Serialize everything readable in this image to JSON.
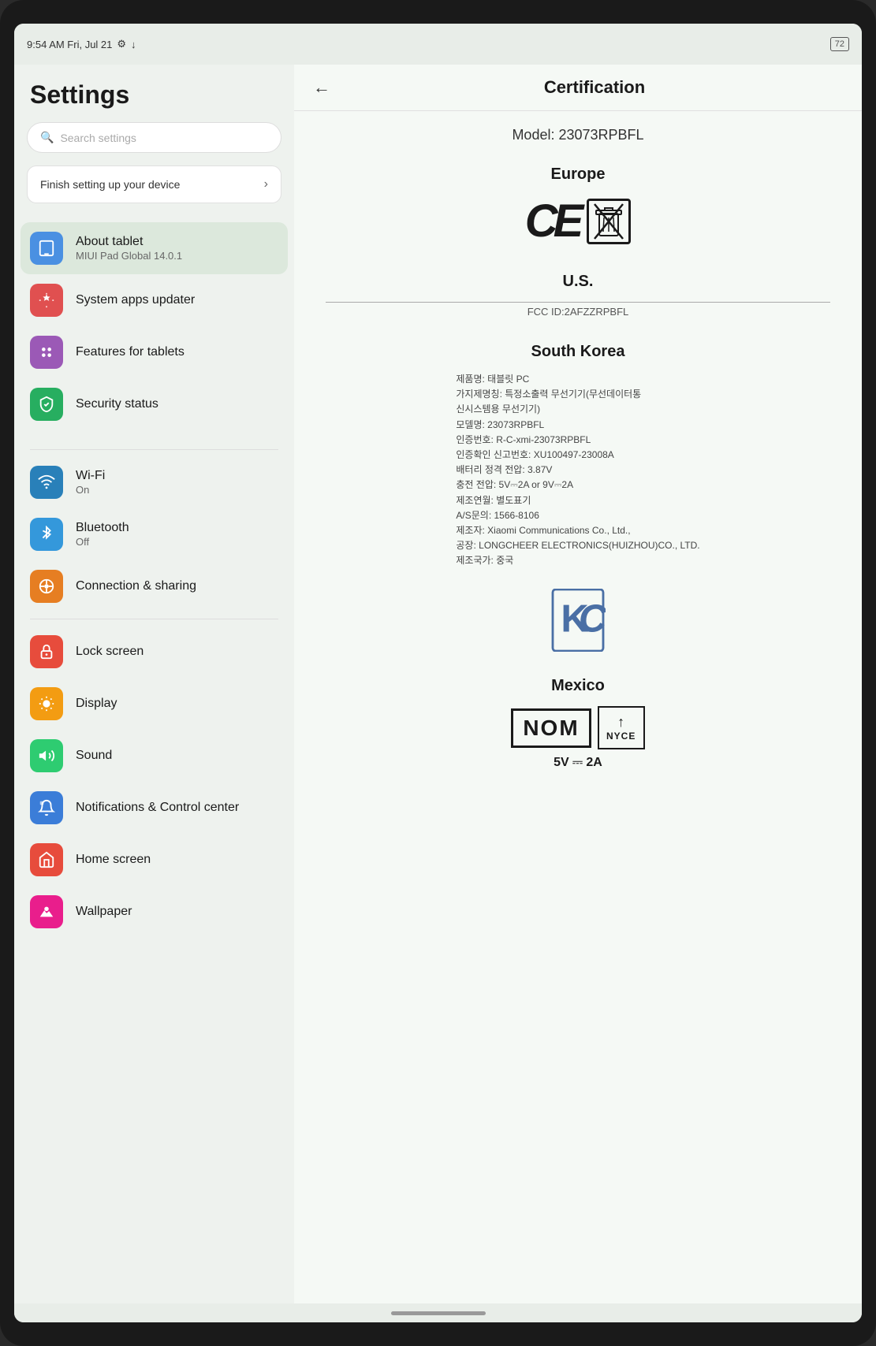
{
  "statusBar": {
    "time": "9:54 AM Fri, Jul 21",
    "battery": "72"
  },
  "sidebar": {
    "title": "Settings",
    "search": {
      "placeholder": "Search settings"
    },
    "setup": {
      "label": "Finish setting up your device"
    },
    "items": [
      {
        "id": "about-tablet",
        "label": "About tablet",
        "sublabel": "MIUI Pad Global 14.0.1",
        "icon": "tablet-icon",
        "iconClass": "icon-blue",
        "iconSymbol": "⊡",
        "active": false
      },
      {
        "id": "system-apps",
        "label": "System apps updater",
        "sublabel": "",
        "icon": "update-icon",
        "iconClass": "icon-red",
        "iconSymbol": "↑",
        "active": false
      },
      {
        "id": "features-tablets",
        "label": "Features for tablets",
        "sublabel": "",
        "icon": "features-icon",
        "iconClass": "icon-purple",
        "iconSymbol": "⋮⋮",
        "active": false
      },
      {
        "id": "security-status",
        "label": "Security status",
        "sublabel": "",
        "icon": "security-icon",
        "iconClass": "icon-green-dark",
        "iconSymbol": "✓",
        "active": false
      },
      {
        "id": "wifi",
        "label": "Wi-Fi",
        "sublabel": "On",
        "icon": "wifi-icon",
        "iconClass": "icon-blue2",
        "iconSymbol": "📶",
        "active": false
      },
      {
        "id": "bluetooth",
        "label": "Bluetooth",
        "sublabel": "Off",
        "icon": "bluetooth-icon",
        "iconClass": "icon-blue3",
        "iconSymbol": "⚡",
        "active": false
      },
      {
        "id": "connection-sharing",
        "label": "Connection & sharing",
        "sublabel": "",
        "icon": "connection-icon",
        "iconClass": "icon-orange",
        "iconSymbol": "⊕",
        "active": false
      },
      {
        "id": "lock-screen",
        "label": "Lock screen",
        "sublabel": "",
        "icon": "lock-icon",
        "iconClass": "icon-red2",
        "iconSymbol": "🔒",
        "active": false
      },
      {
        "id": "display",
        "label": "Display",
        "sublabel": "",
        "icon": "display-icon",
        "iconClass": "icon-orange2",
        "iconSymbol": "☀",
        "active": false
      },
      {
        "id": "sound",
        "label": "Sound",
        "sublabel": "",
        "icon": "sound-icon",
        "iconClass": "icon-green",
        "iconSymbol": "🔔",
        "active": false
      },
      {
        "id": "notifications",
        "label": "Notifications & Control center",
        "sublabel": "",
        "icon": "notifications-icon",
        "iconClass": "icon-blue4",
        "iconSymbol": "🔔",
        "active": false
      },
      {
        "id": "home-screen",
        "label": "Home screen",
        "sublabel": "",
        "icon": "home-icon",
        "iconClass": "icon-red2",
        "iconSymbol": "⌂",
        "active": false
      },
      {
        "id": "wallpaper",
        "label": "Wallpaper",
        "sublabel": "",
        "icon": "wallpaper-icon",
        "iconClass": "icon-pink",
        "iconSymbol": "🌸",
        "active": false
      }
    ]
  },
  "certificationPage": {
    "title": "Certification",
    "backLabel": "←",
    "model": "Model: 23073RPBFL",
    "regions": [
      {
        "name": "Europe",
        "type": "europe"
      },
      {
        "name": "U.S.",
        "fccId": "FCC ID:2AFZZRPBFL",
        "type": "us"
      },
      {
        "name": "South Korea",
        "type": "korea",
        "details": "제품명: 태블릿 PC\n가지제명칭: 특정소출력 무선기기(무선데이터통신시스템용 무선기기)\n모델명: 23073RPBFL\n인증번호: R-C-xmi-23073RPBFL\n인증확인 신고번호: XU100497-23008A\n배터리 정격 전압: 3.87V\n충전 전압: 5V⎓2A or 9V⎓2A\n제조연월: 별도표기\nA/S문의: 1566-8106\n제조자: Xiaomi Communications Co., Ltd.,\n공장: LONGCHEER ELECTRONICS(HUIZHOU)CO., LTD.\n제조국가: 중국"
      },
      {
        "name": "Mexico",
        "type": "mexico",
        "powerSpec": "5V ⎓ 2A"
      }
    ]
  }
}
